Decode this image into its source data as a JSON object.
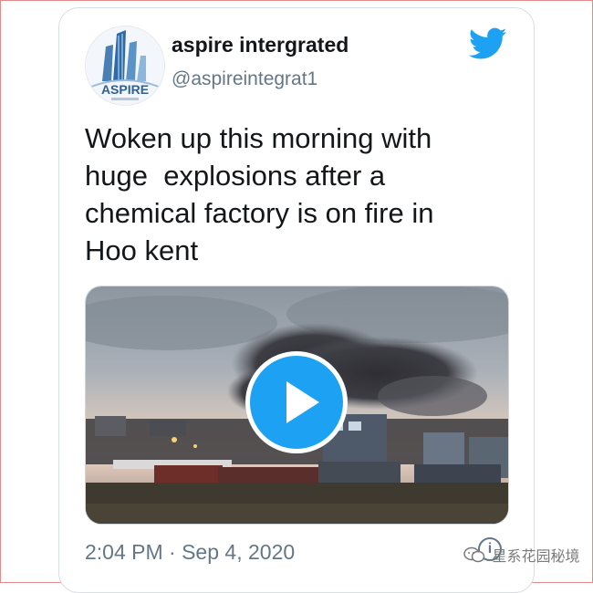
{
  "tweet": {
    "display_name": "aspire intergrated",
    "handle": "@aspireintegrat1",
    "avatar_text": "ASPIRE",
    "text_lines": [
      "Woken up this morning with",
      "huge  explosions after a",
      "chemical factory is on fire in",
      "Hoo kent"
    ],
    "timestamp": "2:04 PM · Sep 4, 2020",
    "brand_color": "#1da1f2",
    "media": {
      "type": "video",
      "icon": "play-icon"
    }
  },
  "watermark": {
    "text": "星系花园秘境",
    "icon": "wechat-icon"
  }
}
